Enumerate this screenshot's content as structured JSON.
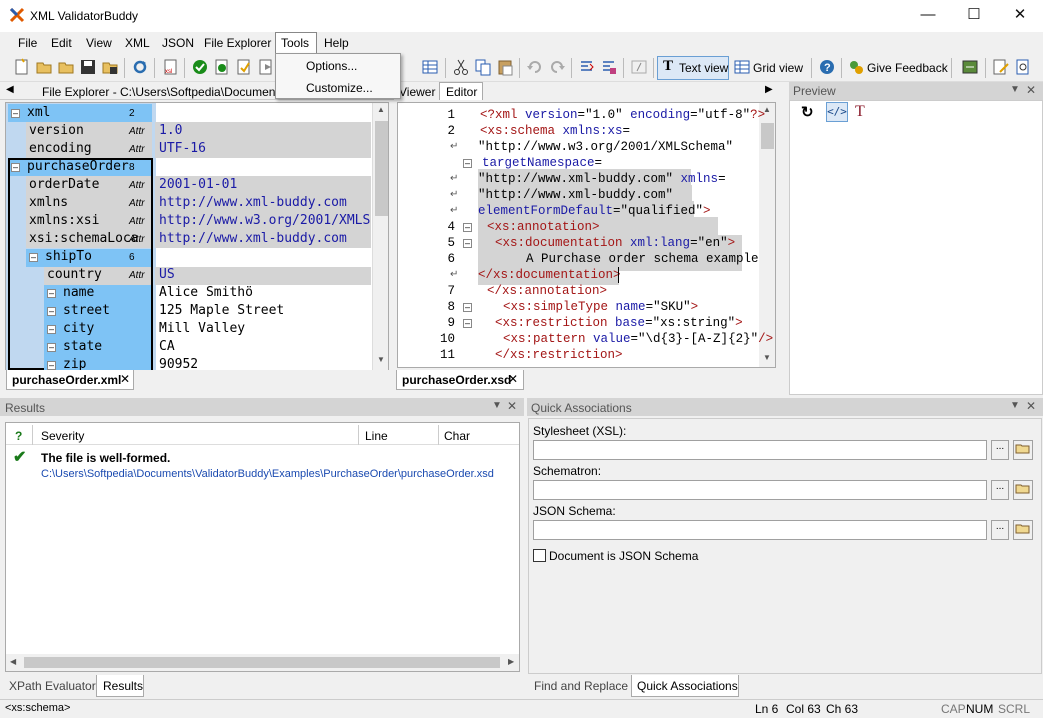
{
  "window": {
    "title": "XML ValidatorBuddy"
  },
  "menu": [
    "File",
    "Edit",
    "View",
    "XML",
    "JSON",
    "File Explorer",
    "Tools",
    "Help"
  ],
  "tools_menu": {
    "items": [
      "Options...",
      "Customize..."
    ]
  },
  "toolbar": {
    "text_view": "Text view",
    "grid_view": "Grid view",
    "give_feedback": "Give Feedback"
  },
  "left_panel": {
    "header": "File Explorer - C:\\Users\\Softpedia\\Documents",
    "tab": "purchaseOrder.xml",
    "rows": [
      {
        "name": "xml",
        "count": "2",
        "value": ""
      },
      {
        "name": "version",
        "attr": "Attr",
        "value": "1.0"
      },
      {
        "name": "encoding",
        "attr": "Attr",
        "value": "UTF-16"
      },
      {
        "name": "purchaseOrder",
        "count": "8",
        "value": ""
      },
      {
        "name": "orderDate",
        "attr": "Attr",
        "value": "2001-01-01"
      },
      {
        "name": "xmlns",
        "attr": "Attr",
        "value": "http://www.xml-buddy.com"
      },
      {
        "name": "xmlns:xsi",
        "attr": "Attr",
        "value": "http://www.w3.org/2001/XMLSch"
      },
      {
        "name": "xsi:schemaLoca",
        "attr": "Attr",
        "value": "http://www.xml-buddy.com"
      },
      {
        "name": "shipTo",
        "count": "6",
        "value": ""
      },
      {
        "name": "country",
        "attr": "Attr",
        "value": "US"
      },
      {
        "name": "name",
        "value": "Alice Smithö"
      },
      {
        "name": "street",
        "value": "125 Maple Street"
      },
      {
        "name": "city",
        "value": "Mill Valley"
      },
      {
        "name": "state",
        "value": "CA"
      },
      {
        "name": "zip",
        "value": "90952"
      }
    ]
  },
  "editor": {
    "tabs": {
      "viewer": "Viewer",
      "editor": "Editor"
    },
    "file_tab": "purchaseOrder.xsd",
    "line_numbers": [
      "1",
      "2",
      "",
      "",
      "",
      "",
      "4",
      "5",
      "6",
      "",
      "7",
      "8",
      "9",
      "10",
      "11"
    ]
  },
  "preview": {
    "title": "Preview"
  },
  "results": {
    "title": "Results",
    "columns": {
      "q": "?",
      "severity": "Severity",
      "line": "Line",
      "char": "Char"
    },
    "message": "The file is well-formed.",
    "path": "C:\\Users\\Softpedia\\Documents\\ValidatorBuddy\\Examples\\PurchaseOrder\\purchaseOrder.xsd",
    "tabs": [
      "XPath Evaluator",
      "Results"
    ]
  },
  "quick": {
    "title": "Quick Associations",
    "stylesheet_label": "Stylesheet (XSL):",
    "schematron_label": "Schematron:",
    "json_schema_label": "JSON Schema:",
    "checkbox_label": "Document is JSON Schema",
    "tabs": [
      "Find and Replace",
      "Quick Associations"
    ]
  },
  "status": {
    "path": "<xs:schema>",
    "ln": "Ln 6",
    "col": "Col 63",
    "ch": "Ch 63",
    "cap": "CAP",
    "num": "NUM",
    "scrl": "SCRL"
  }
}
